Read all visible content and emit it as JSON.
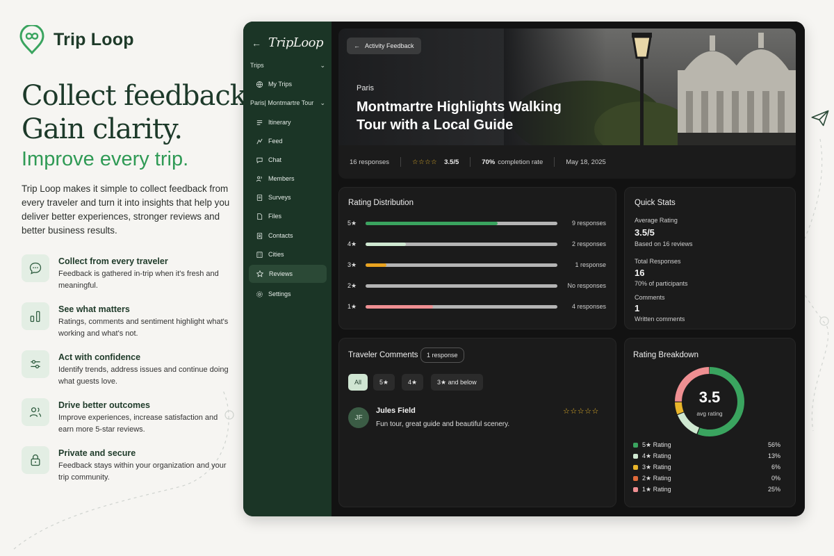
{
  "brand": {
    "name": "Trip Loop"
  },
  "hero_copy": {
    "line1": "Collect feedback.",
    "line2": "Gain clarity.",
    "tagline": "Improve every trip.",
    "intro": "Trip Loop makes it simple to collect feedback from every traveler and turn it into insights that help you deliver better experiences, stronger reviews and better business results."
  },
  "features": [
    {
      "icon": "chat-bubble-icon",
      "title": "Collect from every traveler",
      "desc": "Feedback is gathered in-trip when it's fresh and meaningful."
    },
    {
      "icon": "bar-chart-icon",
      "title": "See what matters",
      "desc": "Ratings, comments and sentiment highlight what's working and what's not."
    },
    {
      "icon": "sliders-icon",
      "title": "Act with confidence",
      "desc": "Identify trends, address issues and continue doing what guests love."
    },
    {
      "icon": "users-icon",
      "title": "Drive better outcomes",
      "desc": "Improve experiences, increase satisfaction and earn more 5-star reviews."
    },
    {
      "icon": "lock-icon",
      "title": "Private and secure",
      "desc": "Feedback stays within your organization and your trip community."
    }
  ],
  "app": {
    "logo": "TripLoop",
    "sidebar": {
      "section_trips": "Trips",
      "my_trips": "My Trips",
      "section_trip": "Paris| Montmartre Tour",
      "items": [
        {
          "label": "Itinerary",
          "icon": "itinerary-icon"
        },
        {
          "label": "Feed",
          "icon": "feed-icon"
        },
        {
          "label": "Chat",
          "icon": "chat-icon"
        },
        {
          "label": "Members",
          "icon": "members-icon"
        },
        {
          "label": "Surveys",
          "icon": "surveys-icon"
        },
        {
          "label": "Files",
          "icon": "files-icon"
        },
        {
          "label": "Contacts",
          "icon": "contacts-icon"
        },
        {
          "label": "Cities",
          "icon": "cities-icon"
        },
        {
          "label": "Reviews",
          "icon": "star-icon",
          "active": true
        },
        {
          "label": "Settings",
          "icon": "settings-icon"
        }
      ]
    },
    "hero": {
      "back_label": "Activity Feedback",
      "city": "Paris",
      "title": "Montmartre Highlights Walking Tour with a Local Guide"
    },
    "summary": {
      "responses": "16 responses",
      "stars": "☆☆☆☆",
      "rating": "3.5/5",
      "completion_value": "70%",
      "completion_label": "completion rate",
      "date": "May 18, 2025"
    },
    "rating_distribution": {
      "title": "Rating Distribution",
      "rows": [
        {
          "label": "5★",
          "fraction": 0.69,
          "color": "#3aa45f",
          "count": "9 responses"
        },
        {
          "label": "4★",
          "fraction": 0.21,
          "color": "#cfe8d1",
          "count": "2 responses"
        },
        {
          "label": "3★",
          "fraction": 0.11,
          "color": "#e9a320",
          "count": "1 response"
        },
        {
          "label": "2★",
          "fraction": 0,
          "color": "#e06a3a",
          "count": "No responses"
        },
        {
          "label": "1★",
          "fraction": 0.35,
          "color": "#ef8f92",
          "count": "4 responses"
        }
      ]
    },
    "quick_stats": {
      "title": "Quick Stats",
      "avg_label": "Average Rating",
      "avg_value": "3.5/5",
      "avg_sub": "Based on 16 reviews",
      "total_label": "Total Responses",
      "total_value": "16",
      "total_sub": "70% of participants",
      "comments_label": "Comments",
      "comments_value": "1",
      "comments_sub": "Written comments"
    },
    "comments": {
      "title": "Traveler Comments",
      "count_pill": "1 response",
      "filters": [
        "All",
        "5★",
        "4★",
        "3★ and below"
      ],
      "items": [
        {
          "initials": "JF",
          "name": "Jules Field",
          "text": "Fun tour, great guide and beautiful scenery.",
          "stars": "☆☆☆☆☆"
        }
      ]
    },
    "breakdown": {
      "title": "Rating Breakdown",
      "center_value": "3.5",
      "center_label": "avg rating",
      "slices": [
        {
          "label": "5★ Rating",
          "percent": "56%",
          "value": 56,
          "color": "#3aa45f"
        },
        {
          "label": "4★ Rating",
          "percent": "13%",
          "value": 13,
          "color": "#cfe8d1"
        },
        {
          "label": "3★ Rating",
          "percent": "6%",
          "value": 6,
          "color": "#e9b52a"
        },
        {
          "label": "2★ Rating",
          "percent": "0%",
          "value": 0,
          "color": "#e06a3a"
        },
        {
          "label": "1★ Rating",
          "percent": "25%",
          "value": 25,
          "color": "#ef8f92"
        }
      ]
    }
  }
}
